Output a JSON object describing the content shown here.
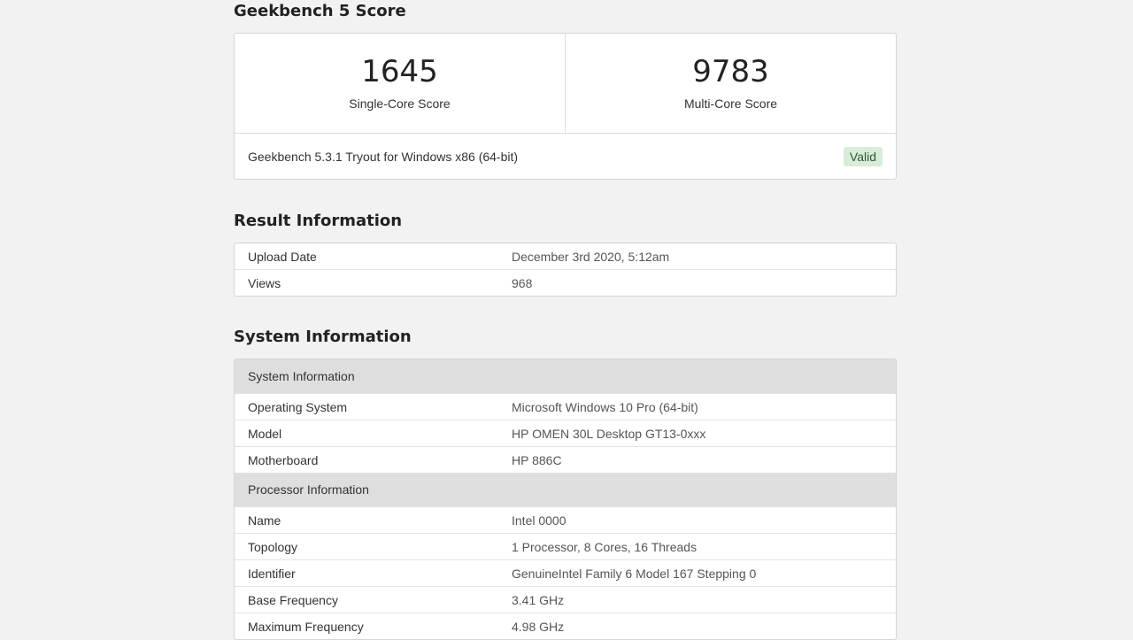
{
  "score_section": {
    "heading": "Geekbench 5 Score",
    "single_core": {
      "value": "1645",
      "label": "Single-Core Score"
    },
    "multi_core": {
      "value": "9783",
      "label": "Multi-Core Score"
    },
    "version_text": "Geekbench 5.3.1 Tryout for Windows x86 (64-bit)",
    "status_badge": "Valid"
  },
  "result_section": {
    "heading": "Result Information",
    "rows": [
      {
        "key": "Upload Date",
        "value": "December 3rd 2020, 5:12am"
      },
      {
        "key": "Views",
        "value": "968"
      }
    ]
  },
  "system_section": {
    "heading": "System Information",
    "groups": [
      {
        "title": "System Information",
        "rows": [
          {
            "key": "Operating System",
            "value": "Microsoft Windows 10 Pro (64-bit)"
          },
          {
            "key": "Model",
            "value": "HP OMEN 30L Desktop GT13-0xxx"
          },
          {
            "key": "Motherboard",
            "value": "HP 886C"
          }
        ]
      },
      {
        "title": "Processor Information",
        "rows": [
          {
            "key": "Name",
            "value": "Intel 0000"
          },
          {
            "key": "Topology",
            "value": "1 Processor, 8 Cores, 16 Threads"
          },
          {
            "key": "Identifier",
            "value": "GenuineIntel Family 6 Model 167 Stepping 0"
          },
          {
            "key": "Base Frequency",
            "value": "3.41 GHz"
          },
          {
            "key": "Maximum Frequency",
            "value": "4.98 GHz"
          }
        ]
      }
    ]
  },
  "colors": {
    "background": "#f2f2f2",
    "card": "#ffffff",
    "section_header": "#dedede",
    "valid_badge_bg": "#d8ecd9"
  }
}
